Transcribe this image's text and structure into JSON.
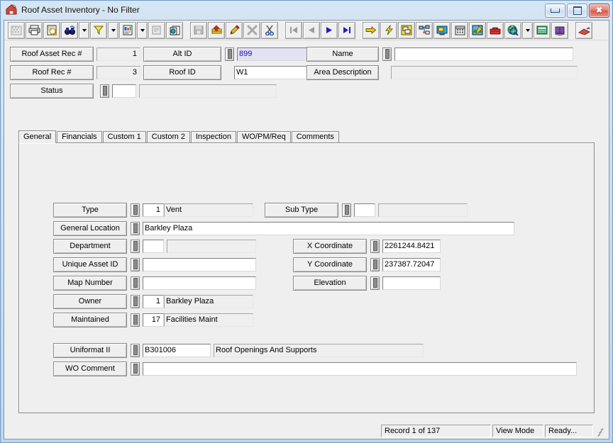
{
  "window": {
    "title": "Roof Asset Inventory - No Filter",
    "icon": "roof-house-icon",
    "buttons": {
      "minimize": "minimize-icon",
      "maximize": "maximize-icon",
      "close": "✖"
    }
  },
  "toolbar": {
    "groups": [
      [
        {
          "name": "grid-view-button",
          "icon": "grid-icon",
          "disabled": true
        },
        {
          "name": "print-button",
          "icon": "printer-icon"
        },
        {
          "name": "print-preview-button",
          "icon": "print-preview-icon"
        },
        {
          "name": "find-button",
          "icon": "binoculars-icon",
          "dropdown": true
        },
        {
          "name": "filter-button",
          "icon": "funnel-icon",
          "dropdown": true
        },
        {
          "name": "report-button",
          "icon": "report-icon",
          "dropdown": true
        },
        {
          "name": "form-properties-button",
          "icon": "form-icon",
          "disabled": true
        },
        {
          "name": "copy-record-button",
          "icon": "copy-icon"
        }
      ],
      [
        {
          "name": "save-button",
          "icon": "save-disk-icon",
          "disabled": true
        },
        {
          "name": "new-record-button",
          "icon": "add-record-icon"
        },
        {
          "name": "edit-button",
          "icon": "pencil-icon"
        },
        {
          "name": "delete-button",
          "icon": "delete-x-icon",
          "disabled": true
        },
        {
          "name": "cut-button",
          "icon": "scissors-icon"
        }
      ],
      [
        {
          "name": "first-record-button",
          "icon": "first-record-icon",
          "disabled": true
        },
        {
          "name": "previous-record-button",
          "icon": "previous-record-icon",
          "disabled": true
        },
        {
          "name": "next-record-button",
          "icon": "next-record-icon"
        },
        {
          "name": "last-record-button",
          "icon": "last-record-icon"
        }
      ],
      [
        {
          "name": "goto-button",
          "icon": "yellow-arrow-icon"
        },
        {
          "name": "quick-action-button",
          "icon": "lightning-bolt-icon"
        },
        {
          "name": "window-layout-button",
          "icon": "window-layout-icon"
        },
        {
          "name": "hierarchy-button",
          "icon": "tree-hierarchy-icon"
        },
        {
          "name": "workstation-button",
          "icon": "monitor-icon"
        },
        {
          "name": "calendar-button",
          "icon": "calendar-icon"
        },
        {
          "name": "drawing-button",
          "icon": "drawing-icon"
        },
        {
          "name": "toolbox-button",
          "icon": "toolbox-icon"
        },
        {
          "name": "gis-search-button",
          "icon": "globe-search-icon",
          "dropdown": true
        },
        {
          "name": "calculator-button",
          "icon": "calculator-icon"
        },
        {
          "name": "help-book-button",
          "icon": "book-icon"
        }
      ],
      [
        {
          "name": "roof-module-button",
          "icon": "roof-icon"
        }
      ]
    ]
  },
  "header": {
    "left": [
      {
        "label": "Roof Asset Rec #",
        "value": "1",
        "readonly": true,
        "numeric": true
      },
      {
        "label": "Roof Rec #",
        "value": "3",
        "readonly": true,
        "numeric": true
      },
      {
        "label": "Status",
        "value": "",
        "desc": "",
        "lookup": true
      }
    ],
    "mid": [
      {
        "label": "Alt ID",
        "value": "899",
        "lookup": true,
        "focused": true
      },
      {
        "label": "Roof ID",
        "value": "W1"
      }
    ],
    "right": [
      {
        "label": "Name",
        "value": "",
        "lookup": true
      },
      {
        "label": "Area Description",
        "value": "",
        "readonly": true
      }
    ]
  },
  "tabs": [
    {
      "label": "General",
      "active": true
    },
    {
      "label": "Financials",
      "active": false
    },
    {
      "label": "Custom 1",
      "active": false
    },
    {
      "label": "Custom 2",
      "active": false
    },
    {
      "label": "Inspection",
      "active": false
    },
    {
      "label": "WO/PM/Req",
      "active": false
    },
    {
      "label": "Comments",
      "active": false
    }
  ],
  "general": {
    "type": {
      "label": "Type",
      "code": "1",
      "desc": "Vent"
    },
    "sub_type": {
      "label": "Sub Type",
      "code": "",
      "desc": ""
    },
    "general_location": {
      "label": "General Location",
      "value": "Barkley Plaza"
    },
    "department": {
      "label": "Department",
      "code": "",
      "desc": ""
    },
    "unique_asset_id": {
      "label": "Unique Asset ID",
      "value": ""
    },
    "map_number": {
      "label": "Map Number",
      "value": ""
    },
    "owner": {
      "label": "Owner",
      "code": "1",
      "desc": "Barkley Plaza"
    },
    "maintained": {
      "label": "Maintained",
      "code": "17",
      "desc": "Facilities Maint"
    },
    "x_coordinate": {
      "label": "X Coordinate",
      "value": "2261244.8421"
    },
    "y_coordinate": {
      "label": "Y Coordinate",
      "value": "237387.72047"
    },
    "elevation": {
      "label": "Elevation",
      "value": ""
    },
    "uniformat": {
      "label": "Uniformat II",
      "code": "B301006",
      "desc": "Roof Openings And Supports"
    },
    "wo_comment": {
      "label": "WO Comment",
      "value": ""
    }
  },
  "statusbar": {
    "record": "Record 1 of 137",
    "mode": "View Mode",
    "state": "Ready..."
  }
}
